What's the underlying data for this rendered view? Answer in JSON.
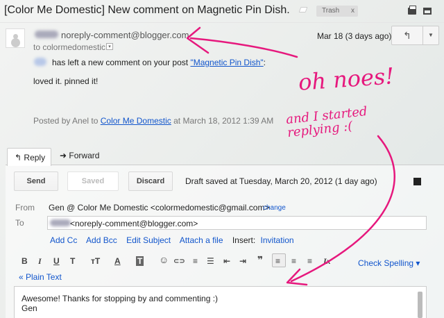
{
  "thread": {
    "subject": "[Color Me Domestic] New comment on Magnetic Pin Dish.",
    "label": "Trash",
    "label_remove": "x"
  },
  "message": {
    "sender_email": "noreply-comment@blogger.com",
    "to_line": "to colormedomestic",
    "to_dropdown": "▾",
    "date": "Mar 18 (3 days ago)",
    "reply_icon": "reply-arrow-icon",
    "more_icon": "chevron-down-icon",
    "comment_intro": "has left a new comment on your post ",
    "post_title_link": "\"Magnetic Pin Dish\"",
    "comment_intro_end": ":",
    "comment_body": "loved it. pinned it!",
    "posted_prefix": "Posted by Anel to ",
    "blog_link": "Color Me Domestic",
    "posted_suffix": " at March 18, 2012 1:39 AM"
  },
  "reply": {
    "tabs": [
      {
        "label": "Reply",
        "icon": "reply-arrow-icon"
      },
      {
        "label": "Forward",
        "icon": "forward-arrow-icon"
      }
    ],
    "send_label": "Send",
    "saved_label": "Saved",
    "discard_label": "Discard",
    "draft_status": "Draft saved at Tuesday, March 20, 2012 (1 day ago)",
    "from_label": "From",
    "from_value": "Gen @ Color Me Domestic <colormedomestic@gmail.com>",
    "change_label": "change",
    "to_label": "To",
    "to_value": "<noreply-comment@blogger.com>",
    "add_cc": "Add Cc",
    "add_bcc": "Add Bcc",
    "edit_subject": "Edit Subject",
    "attach": "Attach a file",
    "insert_label": "Insert:",
    "invitation": "Invitation",
    "check_spelling": "Check Spelling ▾",
    "plain_text": "« Plain Text",
    "body_line1": "Awesome! Thanks for stopping by and commenting :)",
    "body_line2": "Gen"
  },
  "toolbar": {
    "bold": "B",
    "italic": "I",
    "underline": "U",
    "font": "T",
    "size": "тT",
    "color": "A",
    "bg": "T",
    "emoji": "☺",
    "link": "⊂⊃",
    "numbered": "≡",
    "bulleted": "☰",
    "indent_less": "⇤",
    "indent_more": "⇥",
    "quote": "❞",
    "align_left": "≡",
    "align_center": "≡",
    "align_right": "≡",
    "clear": "Ix"
  },
  "annotations": {
    "oh_noes": "oh noes!",
    "started_line1": "and I started",
    "started_line2": "replying :(",
    "color": "#e6187d"
  }
}
